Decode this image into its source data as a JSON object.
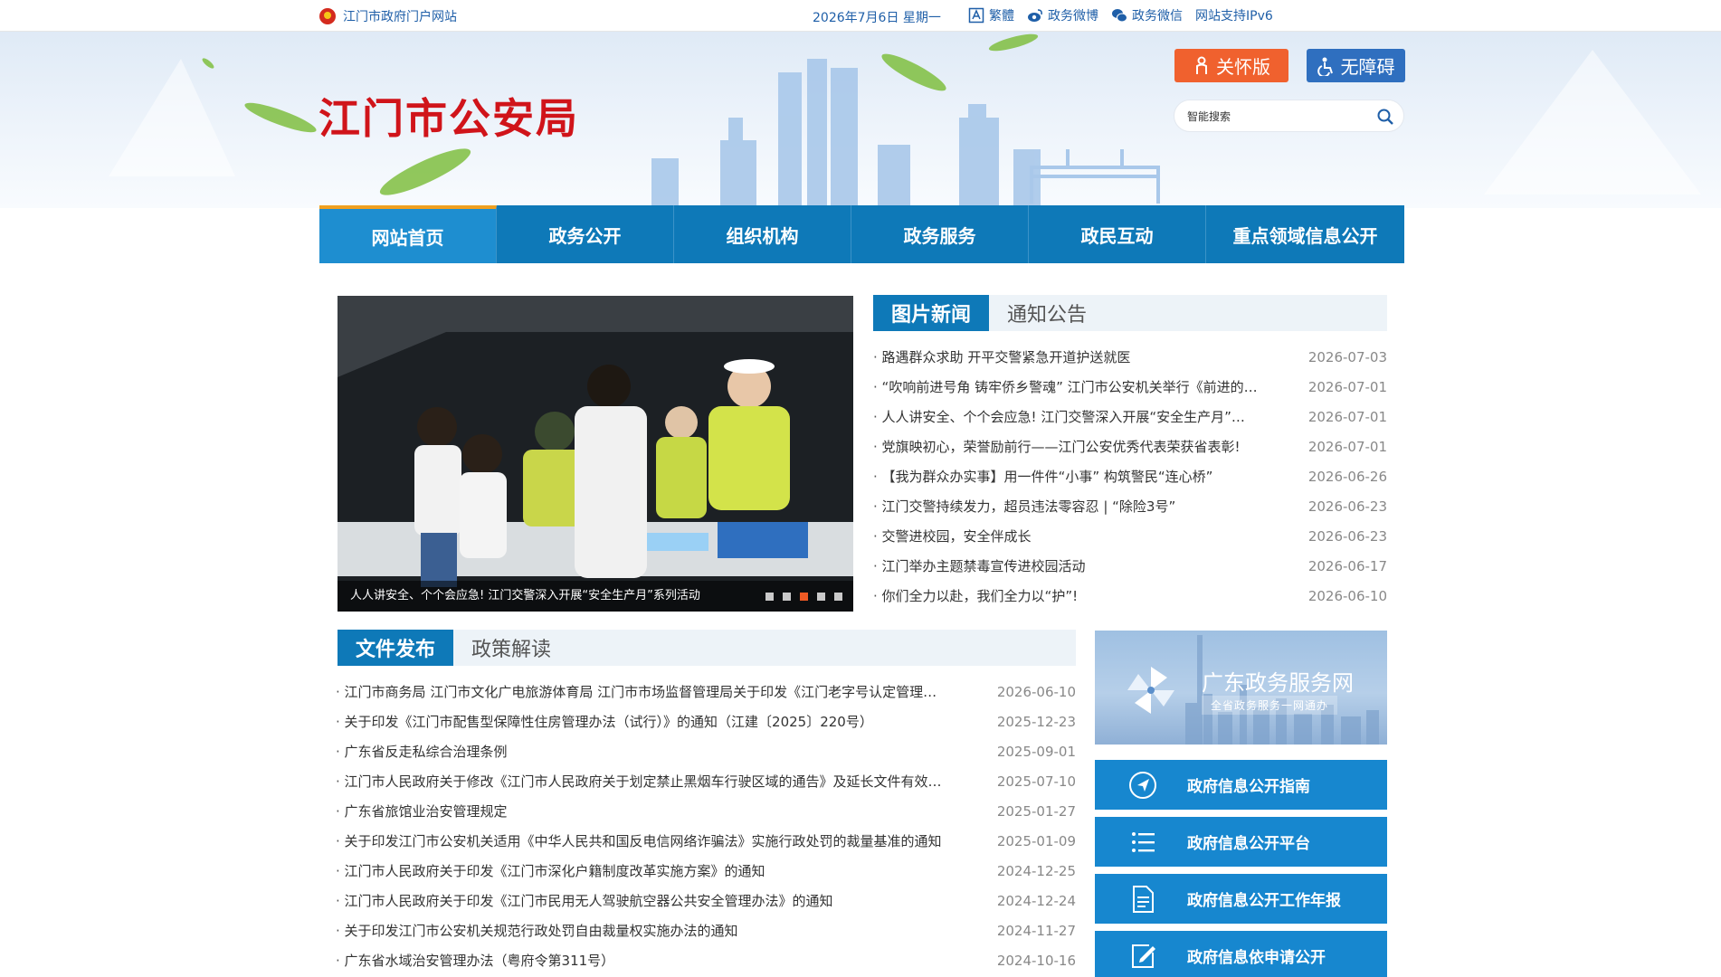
{
  "topbar": {
    "portal_label": "江门市政府门户网站",
    "date": "2026年7月6日 星期一",
    "tools": [
      {
        "label": "繁體",
        "icon": "traditional-chinese-icon"
      },
      {
        "label": "政务微博",
        "icon": "weibo-icon"
      },
      {
        "label": "政务微信",
        "icon": "wechat-icon"
      },
      {
        "label": "网站支持IPv6",
        "icon": ""
      }
    ]
  },
  "header": {
    "title": "江门市公安局",
    "care_label": "关怀版",
    "access_label": "无障碍",
    "search_placeholder": "智能搜索"
  },
  "nav": {
    "items": [
      "网站首页",
      "政务公开",
      "组织机构",
      "政务服务",
      "政民互动",
      "重点领域信息公开"
    ],
    "active_index": 0
  },
  "slider": {
    "caption": "人人讲安全、个个会应急! 江门交警深入开展“安全生产月”系列活动",
    "dot_count": 5,
    "active_dot": 2
  },
  "news": {
    "tabs": [
      "图片新闻",
      "通知公告"
    ],
    "active_tab": 0,
    "items": [
      {
        "title": "路遇群众求助 开平交警紧急开道护送就医",
        "date": "2026-07-03"
      },
      {
        "title": "“吹响前进号角 铸牢侨乡警魂” 江门市公安机关举行《前进的…",
        "date": "2026-07-01"
      },
      {
        "title": "人人讲安全、个个会应急! 江门交警深入开展“安全生产月”…",
        "date": "2026-07-01"
      },
      {
        "title": "党旗映初心，荣誉励前行——江门公安优秀代表荣获省表彰!",
        "date": "2026-07-01"
      },
      {
        "title": "【我为群众办实事】用一件件“小事” 构筑警民“连心桥”",
        "date": "2026-06-26"
      },
      {
        "title": "江门交警持续发力，超员违法零容忍 | “除险3号”",
        "date": "2026-06-23"
      },
      {
        "title": "交警进校园，安全伴成长",
        "date": "2026-06-23"
      },
      {
        "title": "江门举办主题禁毒宣传进校园活动",
        "date": "2026-06-17"
      },
      {
        "title": "你们全力以赴，我们全力以“护”!",
        "date": "2026-06-10"
      }
    ]
  },
  "files": {
    "tabs": [
      "文件发布",
      "政策解读"
    ],
    "active_tab": 0,
    "items": [
      {
        "title": "江门市商务局 江门市文化广电旅游体育局 江门市市场监督管理局关于印发《江门老字号认定管理…",
        "date": "2026-06-10"
      },
      {
        "title": "关于印发《江门市配售型保障性住房管理办法（试行）》的通知（江建〔2025〕220号）",
        "date": "2025-12-23"
      },
      {
        "title": "广东省反走私综合治理条例",
        "date": "2025-09-01"
      },
      {
        "title": "江门市人民政府关于修改《江门市人民政府关于划定禁止黑烟车行驶区域的通告》及延长文件有效…",
        "date": "2025-07-10"
      },
      {
        "title": "广东省旅馆业治安管理规定",
        "date": "2025-01-27"
      },
      {
        "title": "关于印发江门市公安机关适用《中华人民共和国反电信网络诈骗法》实施行政处罚的裁量基准的通知",
        "date": "2025-01-09"
      },
      {
        "title": "江门市人民政府关于印发《江门市深化户籍制度改革实施方案》的通知",
        "date": "2024-12-25"
      },
      {
        "title": "江门市人民政府关于印发《江门市民用无人驾驶航空器公共安全管理办法》的通知",
        "date": "2024-12-24"
      },
      {
        "title": "关于印发江门市公安机关规范行政处罚自由裁量权实施办法的通知",
        "date": "2024-11-27"
      },
      {
        "title": "广东省水域治安管理办法（粤府令第311号）",
        "date": "2024-10-16"
      }
    ]
  },
  "sidebar": {
    "gd_title": "广东政务服务网",
    "gd_subtitle": "全省政务服务一网通办",
    "buttons": [
      {
        "label": "政府信息公开指南",
        "icon": "compass-icon"
      },
      {
        "label": "政府信息公开平台",
        "icon": "list-icon"
      },
      {
        "label": "政府信息公开工作年报",
        "icon": "document-icon"
      },
      {
        "label": "政府信息依申请公开",
        "icon": "edit-icon"
      }
    ]
  },
  "colors": {
    "brand_blue": "#0e79b8",
    "title_red": "#d0141a",
    "care_orange": "#f0612e",
    "active_dot": "#ef5a24"
  }
}
